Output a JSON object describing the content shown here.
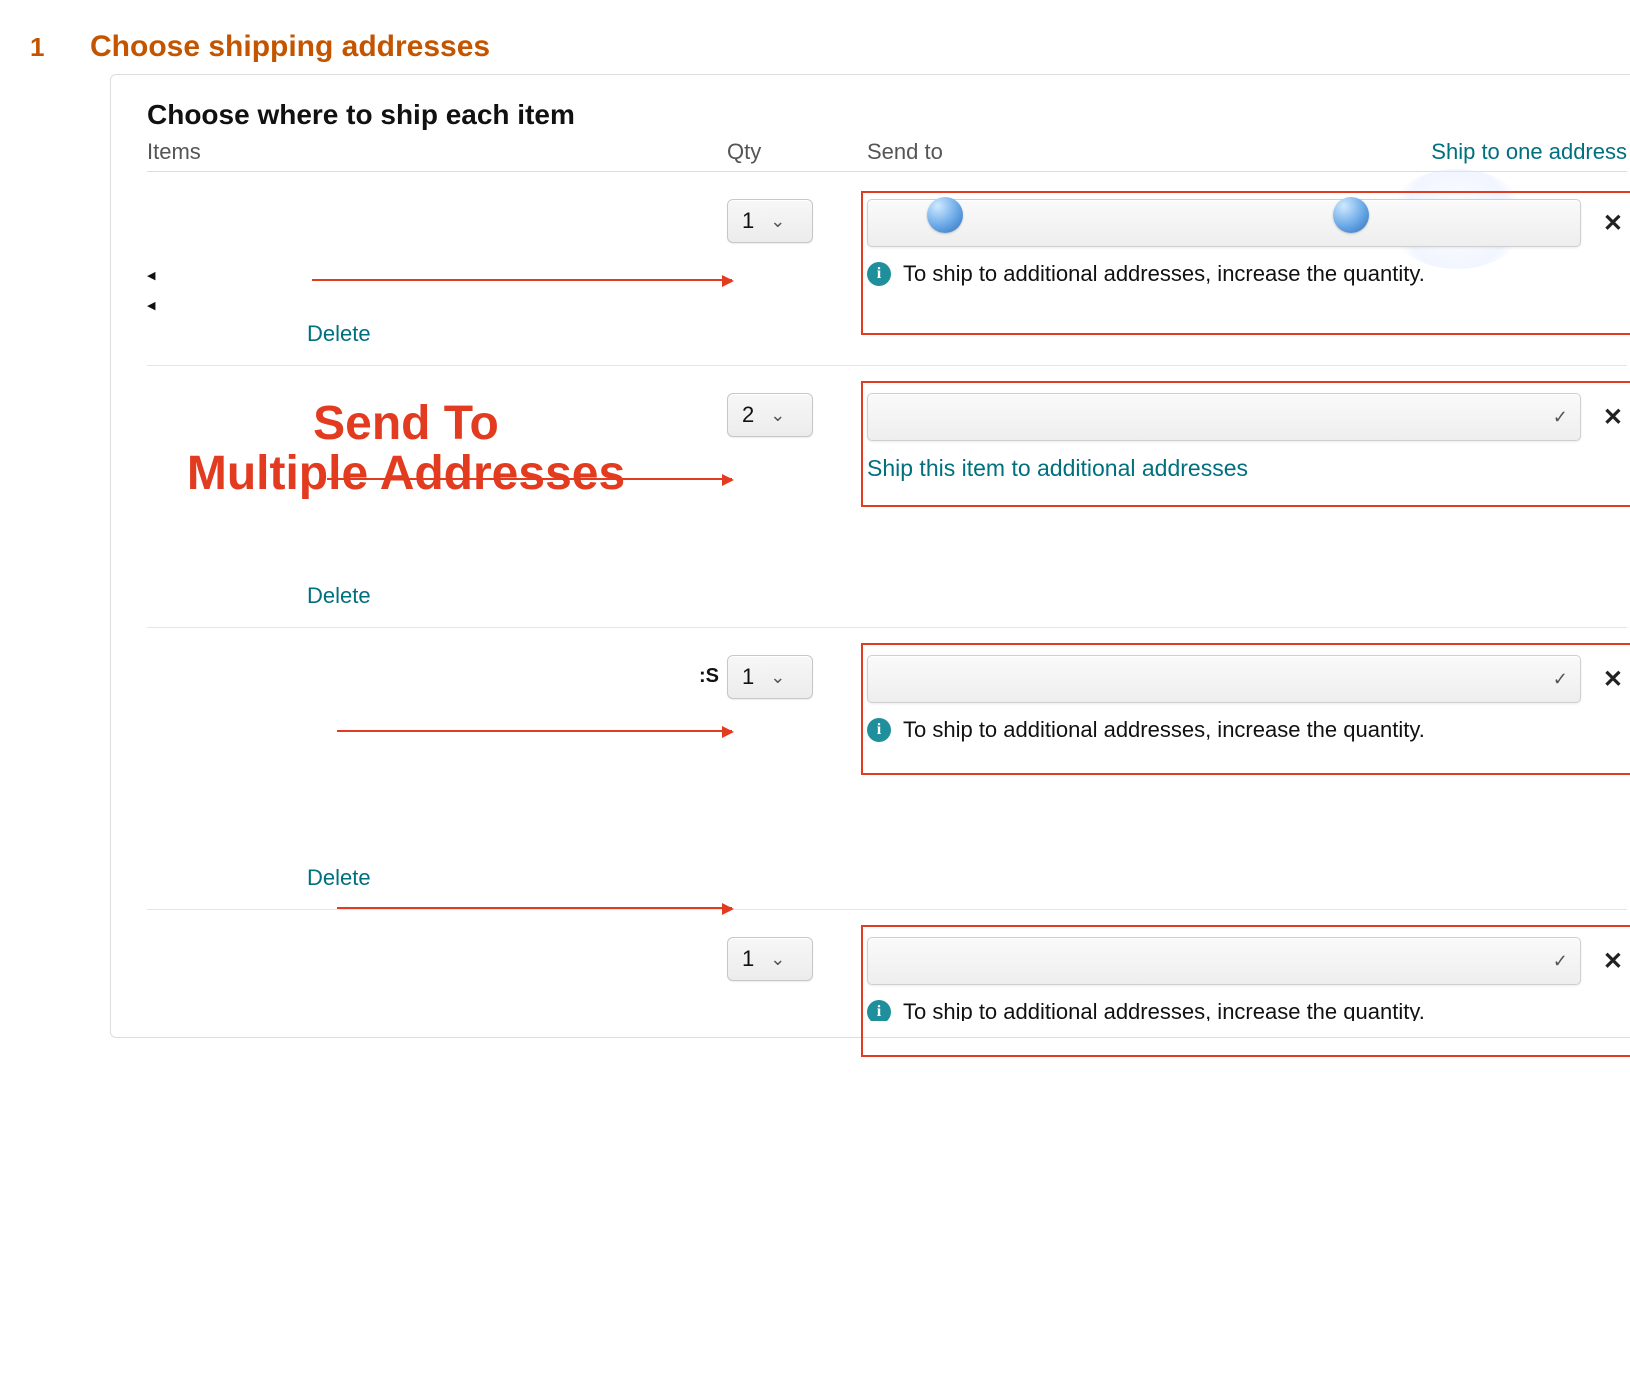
{
  "wizard": {
    "step_number": "1",
    "step_title": "Choose shipping addresses"
  },
  "panel": {
    "heading": "Choose where to ship each item",
    "col_items": "Items",
    "col_qty": "Qty",
    "col_sendto": "Send to",
    "ship_one_link": "Ship to one address"
  },
  "rows": [
    {
      "qty": "1",
      "hint": "To ship to additional addresses, increase the quantity.",
      "action_link": null,
      "delete": "Delete",
      "tail_s": null
    },
    {
      "qty": "2",
      "hint": null,
      "action_link": "Ship this item to additional addresses",
      "delete": "Delete",
      "tail_s": null
    },
    {
      "qty": "1",
      "hint": "To ship to additional addresses, increase the quantity.",
      "action_link": null,
      "delete": "Delete",
      "tail_s": ":S"
    },
    {
      "qty": "1",
      "hint": "To ship to additional addresses, increase the quantity.",
      "action_link": null,
      "delete": null,
      "tail_s": null
    }
  ],
  "icons": {
    "info_glyph": "i",
    "check_glyph": "✓",
    "close_glyph": "✕",
    "chevron_glyph": "⌄"
  },
  "annotation": {
    "big_label_line1": "Send To",
    "big_label_line2": "Multiple Addresses"
  }
}
